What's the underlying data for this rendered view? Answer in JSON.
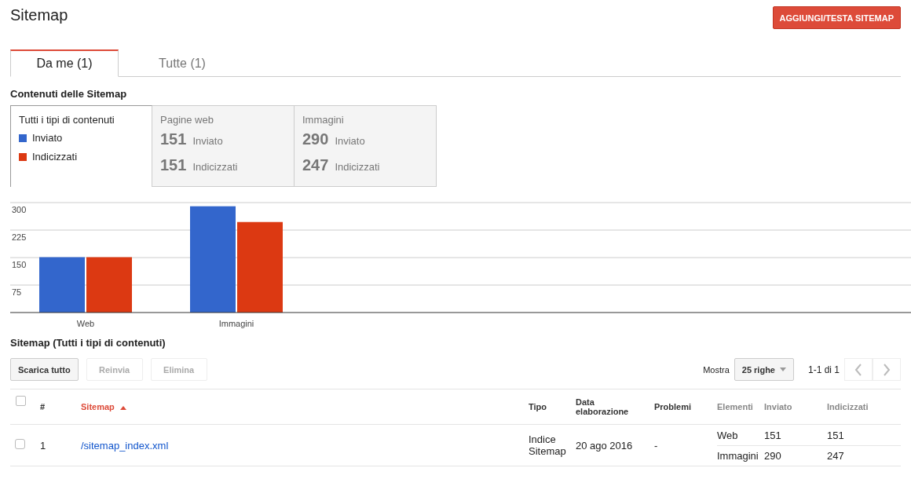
{
  "page": {
    "title": "Sitemap",
    "add_button": "AGGIUNGI/TESTA SITEMAP"
  },
  "tabs": [
    {
      "label": "Da me (1)",
      "selected": true
    },
    {
      "label": "Tutte (1)",
      "selected": false
    }
  ],
  "contents": {
    "title": "Contenuti delle Sitemap",
    "cards": [
      {
        "kind": "legend",
        "title": "Tutti i tipi di contenuti",
        "selected": true
      },
      {
        "kind": "stats",
        "title": "Pagine web",
        "selected": false,
        "stats": [
          {
            "value": "151",
            "label": "Inviato"
          },
          {
            "value": "151",
            "label": "Indicizzati"
          }
        ]
      },
      {
        "kind": "stats",
        "title": "Immagini",
        "selected": false,
        "stats": [
          {
            "value": "290",
            "label": "Inviato"
          },
          {
            "value": "247",
            "label": "Indicizzati"
          }
        ]
      }
    ]
  },
  "chart_data": {
    "type": "bar",
    "categories": [
      "Web",
      "Immagini"
    ],
    "series": [
      {
        "name": "Inviato",
        "color": "#3366cc",
        "values": [
          151,
          290
        ]
      },
      {
        "name": "Indicizzati",
        "color": "#dc3912",
        "values": [
          151,
          247
        ]
      }
    ],
    "ylim": [
      0,
      300
    ],
    "yticks": [
      75,
      150,
      225,
      300
    ],
    "grid": true
  },
  "sitemaps": {
    "title": "Sitemap (Tutti i tipi di contenuti)",
    "buttons": [
      {
        "label": "Scarica tutto",
        "disabled": false
      },
      {
        "label": "Reinvia",
        "disabled": true
      },
      {
        "label": "Elimina",
        "disabled": true
      }
    ],
    "show_label": "Mostra",
    "rows_select": "25 righe",
    "range": "1-1 di 1",
    "prev_disabled": true,
    "next_disabled": true,
    "header_checked": false,
    "columns": [
      {
        "label": "#",
        "sorted": false,
        "muted": false
      },
      {
        "label": "Sitemap",
        "sorted": true,
        "muted": false
      },
      {
        "label": "Tipo",
        "sorted": false,
        "muted": false
      },
      {
        "label": "Data elaborazione",
        "sorted": false,
        "muted": false
      },
      {
        "label": "Problemi",
        "sorted": false,
        "muted": false
      },
      {
        "label": "Elementi",
        "sorted": false,
        "muted": true
      },
      {
        "label": "Inviato",
        "sorted": false,
        "muted": true
      },
      {
        "label": "Indicizzati",
        "sorted": false,
        "muted": true
      }
    ],
    "rows": [
      {
        "checked": false,
        "index": "1",
        "sitemap": "/sitemap_index.xml",
        "type": "Indice Sitemap",
        "date": "20 ago 2016",
        "problems": "-",
        "elements": [
          {
            "name": "Web",
            "submitted": "151",
            "indexed": "151"
          },
          {
            "name": "Immagini",
            "submitted": "290",
            "indexed": "247"
          }
        ]
      }
    ]
  }
}
